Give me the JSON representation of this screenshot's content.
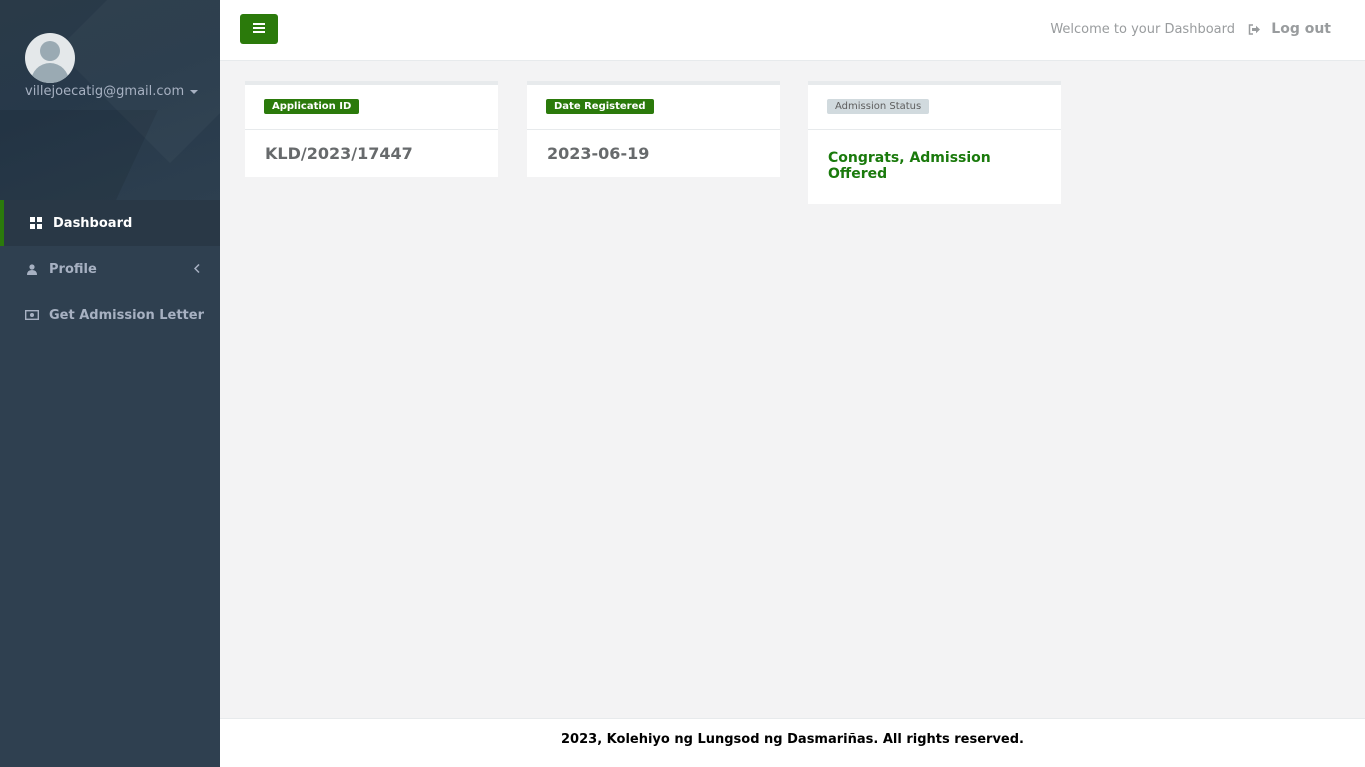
{
  "user": {
    "email": "villejoecatig@gmail.com"
  },
  "sidebar": {
    "items": [
      {
        "label": "Dashboard",
        "icon": "grid-icon",
        "active": true
      },
      {
        "label": "Profile",
        "icon": "user-icon",
        "active": false
      },
      {
        "label": "Get Admission Letter",
        "icon": "money-icon",
        "active": false
      }
    ]
  },
  "topbar": {
    "welcome": "Welcome to your Dashboard",
    "logout": "Log out"
  },
  "cards": {
    "application": {
      "label": "Application ID",
      "value": "KLD/2023/17447"
    },
    "date": {
      "label": "Date Registered",
      "value": "2023-06-19"
    },
    "status": {
      "label": "Admission Status",
      "value": "Congrats, Admission Offered"
    }
  },
  "footer": {
    "text": "2023, Kolehiyo ng Lungsod ng Dasmariñas. All rights reserved."
  },
  "colors": {
    "accent": "#2b7a0b",
    "sidebar": "#2f4050",
    "status_text": "#1a7a0c"
  }
}
